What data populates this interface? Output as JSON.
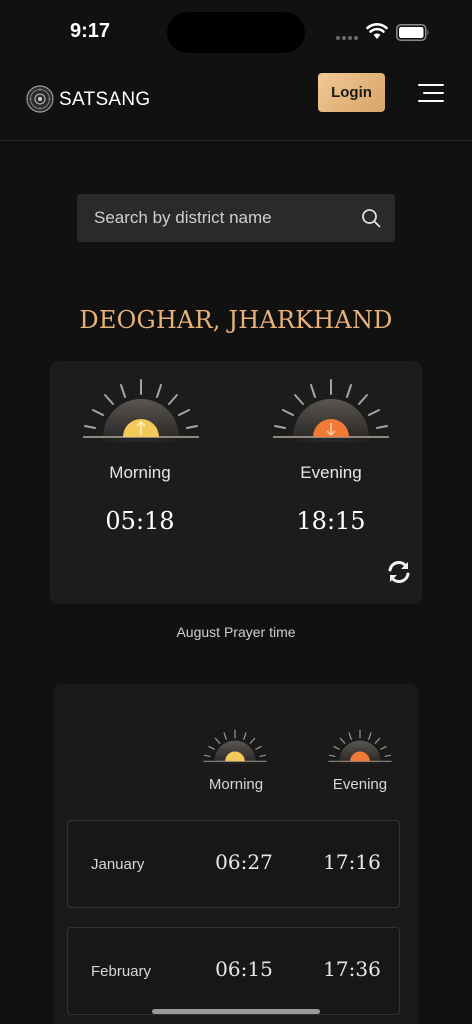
{
  "status_bar": {
    "time": "9:17"
  },
  "header": {
    "brand": "SATSANG",
    "login_label": "Login"
  },
  "search": {
    "placeholder": "Search by district name"
  },
  "location": {
    "title": "DEOGHAR, JHARKHAND"
  },
  "today": {
    "morning": {
      "label": "Morning",
      "time": "05:18"
    },
    "evening": {
      "label": "Evening",
      "time": "18:15"
    }
  },
  "month_note": "August Prayer time",
  "monthly": {
    "columns": {
      "morning": "Morning",
      "evening": "Evening"
    },
    "rows": [
      {
        "month": "January",
        "morning": "06:27",
        "evening": "17:16"
      },
      {
        "month": "February",
        "morning": "06:15",
        "evening": "17:36"
      }
    ]
  },
  "colors": {
    "accent": "#e9b27a",
    "login_gradient_start": "#f1c894",
    "login_gradient_end": "#d7a46a",
    "morning_sun": "#f4c85a",
    "evening_sun": "#f07a36",
    "background": "#111111",
    "card": "#1c1c1c"
  },
  "icons": {
    "logo": "satsang-emblem-icon",
    "menu": "hamburger-menu-icon",
    "search": "search-icon",
    "refresh": "refresh-icon",
    "morning": "sunrise-icon",
    "evening": "sunset-icon"
  }
}
